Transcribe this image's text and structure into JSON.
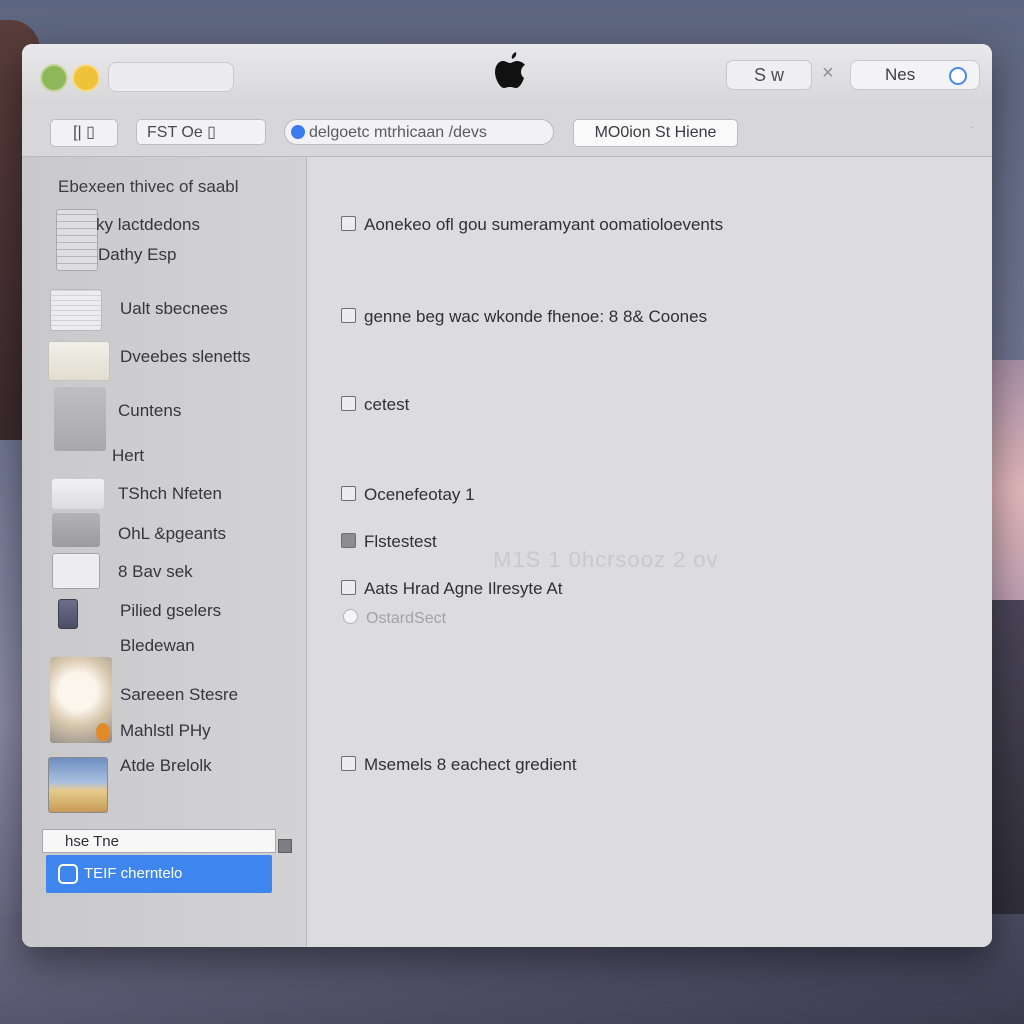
{
  "titlebar": {
    "search_text": "S w",
    "close_glyph": "×",
    "notes_label": "Nes",
    "logo": "apple-logo"
  },
  "toolbar": {
    "icons_label": "[| ▯",
    "fst_label": "FST   Oe ▯",
    "device_label": "delgoetc mtrhicaan /devs",
    "option_label": "MO0ion St Hiene"
  },
  "sidebar": {
    "header": "Ebexeen thivec of saabl",
    "items": [
      {
        "label": "ky lactdedons",
        "icon": "calculator-icon"
      },
      {
        "label": "Dathy Esp",
        "icon": ""
      },
      {
        "label": "Ualt sbecnees",
        "icon": "document-icon"
      },
      {
        "label": "Dveebes slenetts",
        "icon": "folder-icon"
      },
      {
        "label": "Cuntens",
        "icon": "contacts-icon"
      },
      {
        "label": "Hert",
        "icon": ""
      },
      {
        "label": "TShch Nfeten",
        "icon": "note-icon"
      },
      {
        "label": "OhL &pgeants",
        "icon": "app-icon"
      },
      {
        "label": "8 Bav sek",
        "icon": "notepad-icon"
      },
      {
        "label": "Pilied gselers",
        "icon": "book-icon"
      },
      {
        "label": "Bledewan",
        "icon": ""
      },
      {
        "label": "Sareeen Stesre",
        "icon": "photo-icon"
      },
      {
        "label": "Mahlstl PHy",
        "icon": ""
      },
      {
        "label": "Atde  Brelolk",
        "icon": "landscape-icon"
      }
    ],
    "input_value": "hse Tne",
    "selected_label": "TEIF cherntelo"
  },
  "content": {
    "options": [
      {
        "label": "Aonekeo ofl gou sumeramyant oomatioloevents",
        "checked": false
      },
      {
        "label": "genne beg wac wkonde fhenoe: 8 8& Coones",
        "checked": false
      },
      {
        "label": "cetest",
        "checked": false
      },
      {
        "label": "Ocenefeotay 1",
        "checked": false
      },
      {
        "label": "Flstestest",
        "checked": true
      },
      {
        "label": "Aats Hrad Agne Ilresyte At",
        "checked": false
      },
      {
        "label": "Msemels 8 eachect gredient",
        "checked": false
      }
    ],
    "radio_label": "OstardSect",
    "watermark": "M1S 1 0hcrsooz 2 ov"
  },
  "colors": {
    "accent": "#3e86ee",
    "window": "#dcdcdf",
    "sidebar": "#cfcfd2"
  }
}
